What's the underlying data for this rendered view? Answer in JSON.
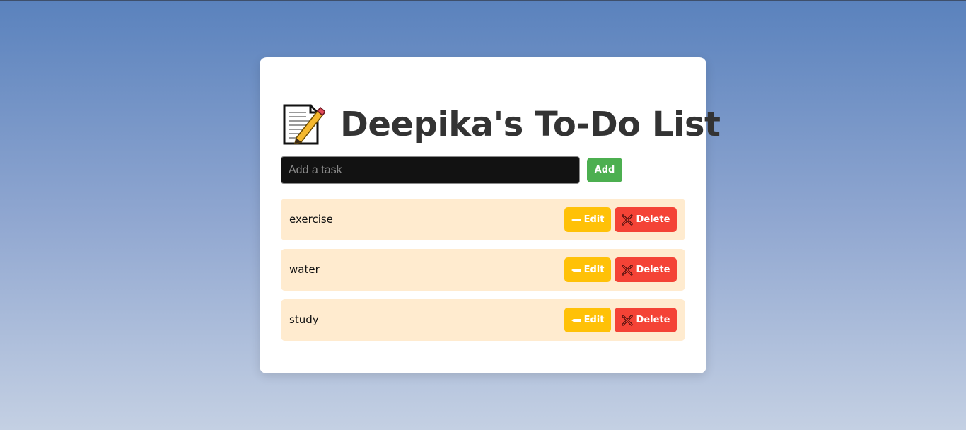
{
  "header": {
    "title": "Deepika's To-Do List",
    "icon": "memo-icon"
  },
  "input": {
    "placeholder": "Add a task",
    "value": ""
  },
  "add_button": {
    "label": "Add"
  },
  "tasks": [
    {
      "text": "exercise",
      "edit_label": "Edit",
      "delete_label": "Delete"
    },
    {
      "text": "water",
      "edit_label": "Edit",
      "delete_label": "Delete"
    },
    {
      "text": "study",
      "edit_label": "Edit",
      "delete_label": "Delete"
    }
  ],
  "colors": {
    "add": "#4caf50",
    "edit": "#ffc107",
    "delete": "#f44336",
    "task_bg": "#ffebcf",
    "title": "#333333"
  },
  "icons": {
    "edit": "pencil-icon",
    "delete": "cross-mark-icon"
  }
}
